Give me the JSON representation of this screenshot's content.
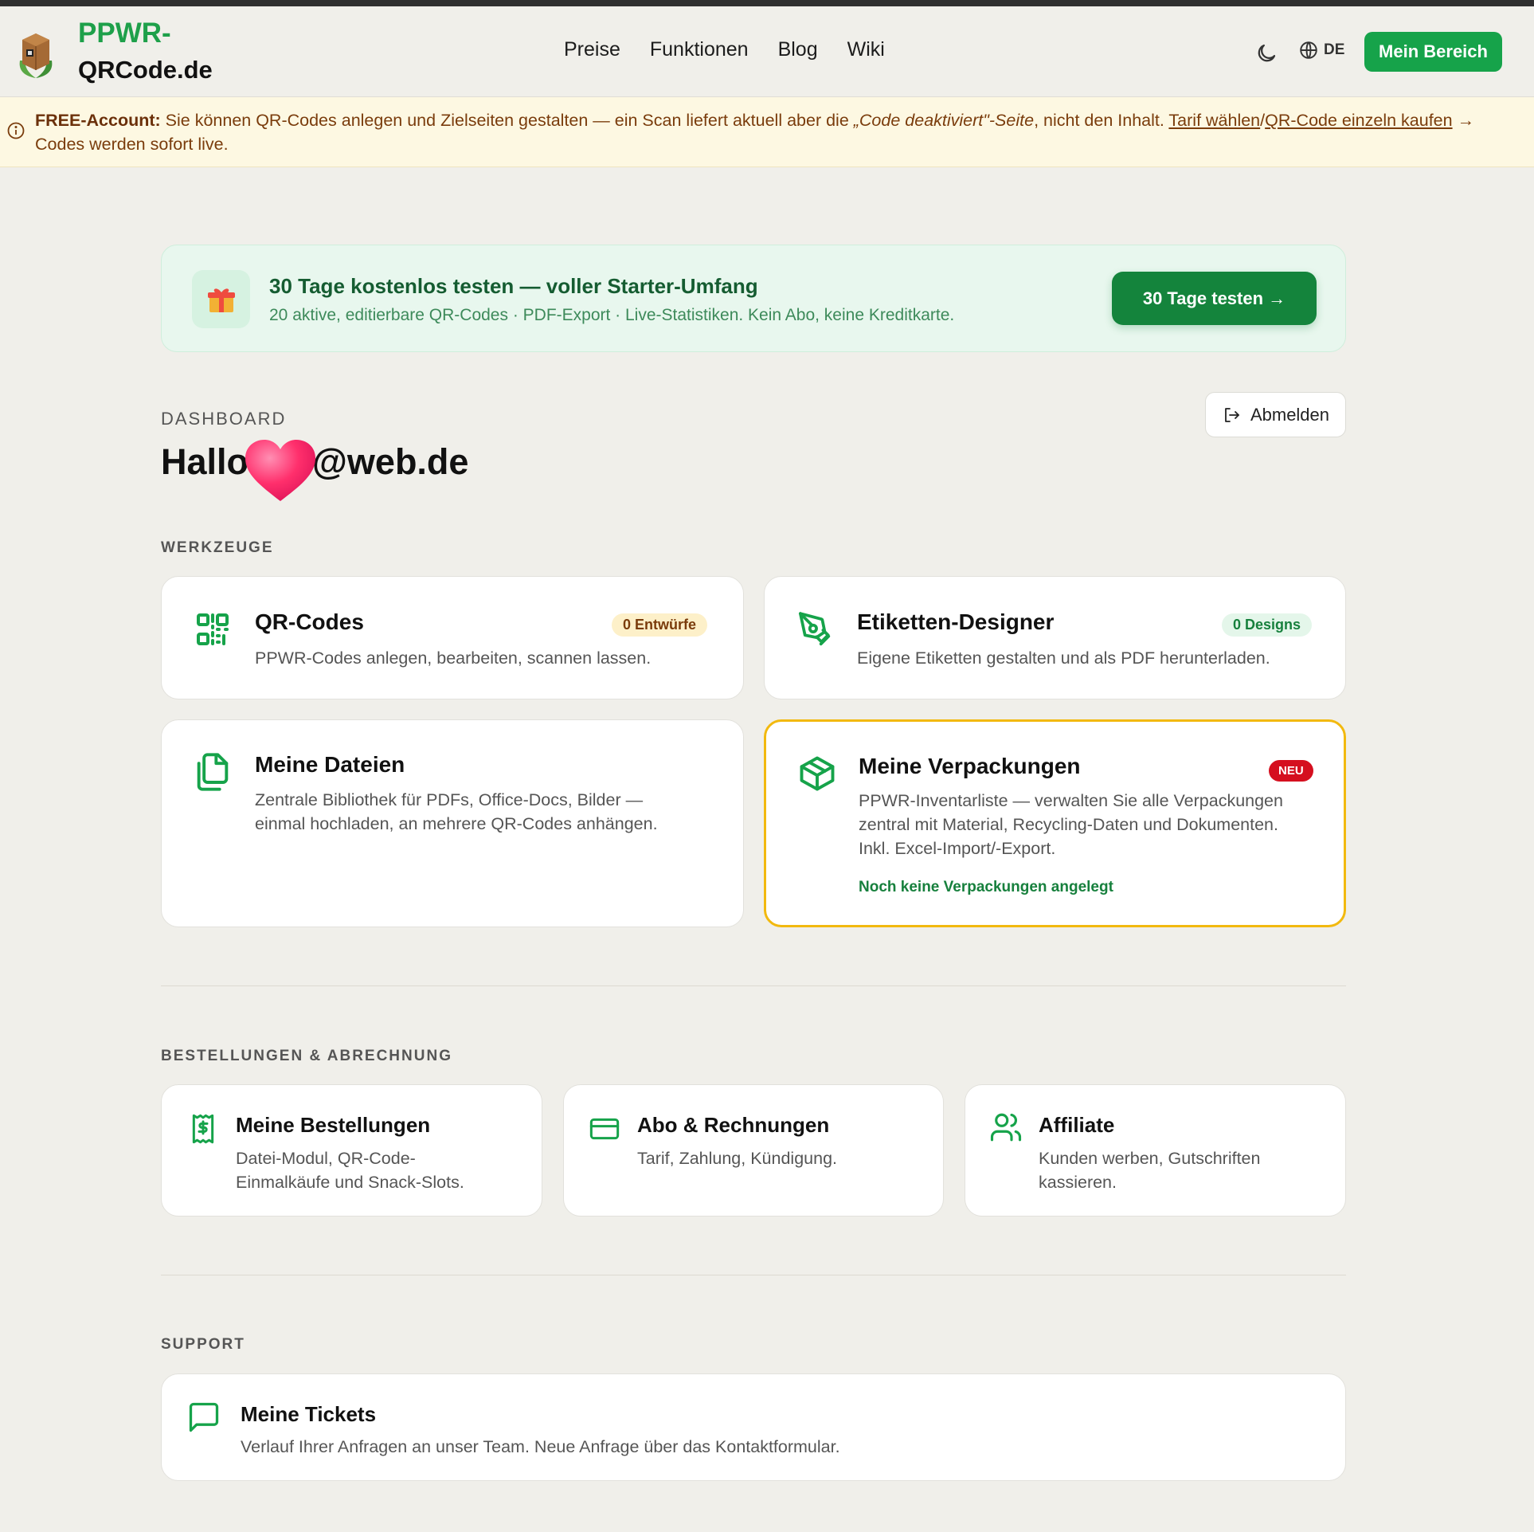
{
  "header": {
    "logo_line1": "PPWR-",
    "logo_line2": "QRCode.de",
    "nav": [
      "Preise",
      "Funktionen",
      "Blog",
      "Wiki"
    ],
    "lang": "DE",
    "mein_bereich": "Mein Bereich"
  },
  "notice": {
    "label": "FREE-Account:",
    "text1": " Sie können QR-Codes anlegen und Zielseiten gestalten — ein Scan liefert aktuell aber die ",
    "italic": "„Code deaktiviert\"-Seite",
    "text2": ", nicht den Inhalt.  ",
    "link1": "Tarif wählen",
    "sep": "/",
    "link2": "QR-Code einzeln kaufen",
    "text3": " → Codes werden sofort live."
  },
  "promo": {
    "title": "30 Tage kostenlos testen — voller Starter-Umfang",
    "subtitle": "20 aktive, editierbare QR-Codes · PDF-Export · Live-Statistiken. Kein Abo, keine Kreditkarte.",
    "button": "30 Tage testen →"
  },
  "dashboard": {
    "label": "DASHBOARD",
    "greeting_prefix": "Hallo",
    "greeting_suffix": "@web.de",
    "logout": "Abmelden"
  },
  "sections": {
    "werkzeuge": "WERKZEUGE",
    "bestellungen": "BESTELLUNGEN & ABRECHNUNG",
    "support": "SUPPORT"
  },
  "tools": {
    "qr": {
      "title": "QR-Codes",
      "badge": "0 Entwürfe",
      "desc": "PPWR-Codes anlegen, bearbeiten, scannen lassen."
    },
    "etiketten": {
      "title": "Etiketten-Designer",
      "badge": "0 Designs",
      "desc": "Eigene Etiketten gestalten und als PDF herunterladen."
    },
    "dateien": {
      "title": "Meine Dateien",
      "desc1": "Zentrale Bibliothek für PDFs, Office-Docs, Bilder —",
      "desc2": "einmal hochladen, an mehrere QR-Codes anhängen."
    },
    "verpackungen": {
      "title": "Meine Verpackungen",
      "badge": "NEU",
      "desc1": "PPWR-Inventarliste — verwalten Sie alle Verpackungen",
      "desc2": "zentral mit Material, Recycling-Daten und Dokumenten.",
      "desc3": "Inkl. Excel-Import/-Export.",
      "status": "Noch keine Verpackungen angelegt"
    }
  },
  "billing": {
    "orders": {
      "title": "Meine Bestellungen",
      "desc1": "Datei-Modul, QR-Code-",
      "desc2": "Einmalkäufe und Snack-Slots."
    },
    "abo": {
      "title": "Abo & Rechnungen",
      "desc": "Tarif, Zahlung, Kündigung."
    },
    "affiliate": {
      "title": "Affiliate",
      "desc1": "Kunden werben, Gutschriften",
      "desc2": "kassieren."
    }
  },
  "support": {
    "tickets": {
      "title": "Meine Tickets",
      "desc": "Verlauf Ihrer Anfragen an unser Team. Neue Anfrage über das Kontaktformular."
    }
  },
  "colors": {
    "brand_green": "#16a34a",
    "highlight_border": "#f2b90f",
    "badge_red": "#d50f1f"
  }
}
